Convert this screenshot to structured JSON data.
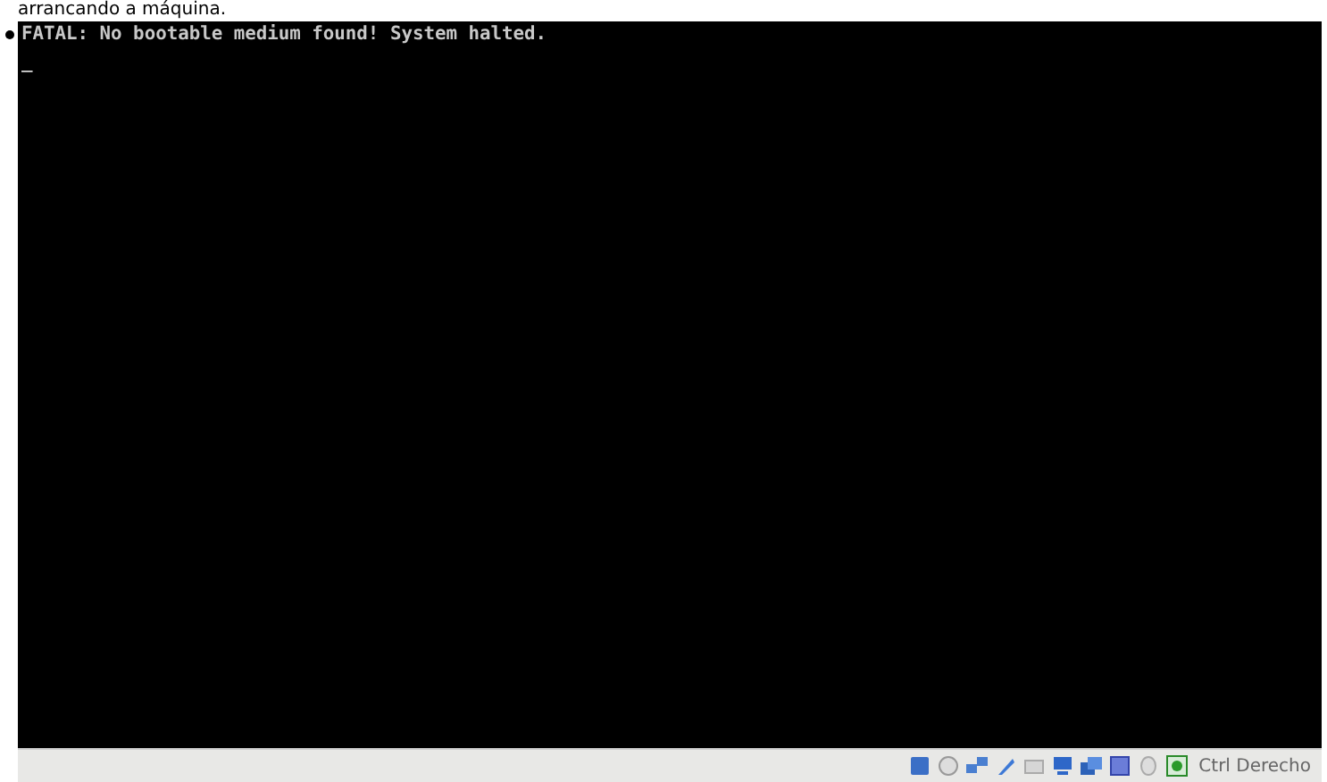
{
  "caption": "arrancando a máquina.",
  "console": {
    "lines": [
      "FATAL: No bootable medium found! System halted.",
      "_"
    ]
  },
  "status_bar": {
    "host_key": "Ctrl Derecho"
  }
}
